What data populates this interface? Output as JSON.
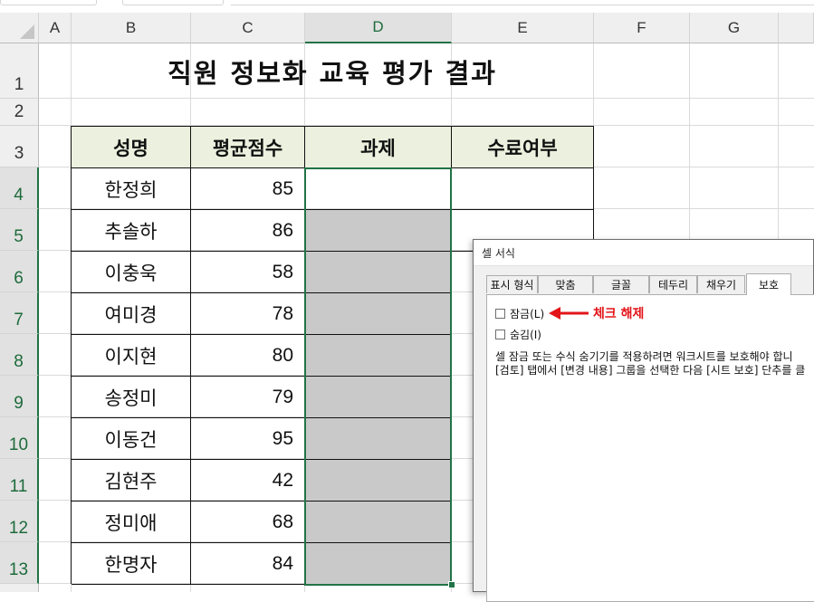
{
  "columns": [
    "A",
    "B",
    "C",
    "D",
    "E",
    "F",
    "G"
  ],
  "rows": [
    "1",
    "2",
    "3",
    "4",
    "5",
    "6",
    "7",
    "8",
    "9",
    "10",
    "11",
    "12",
    "13"
  ],
  "sheet_title": "직원 정보화 교육 평가 결과",
  "table": {
    "headers": [
      "성명",
      "평균점수",
      "과제",
      "수료여부"
    ],
    "records": [
      {
        "name": "한정희",
        "score": "85"
      },
      {
        "name": "추솔하",
        "score": "86"
      },
      {
        "name": "이충욱",
        "score": "58"
      },
      {
        "name": "여미경",
        "score": "78"
      },
      {
        "name": "이지현",
        "score": "80"
      },
      {
        "name": "송정미",
        "score": "79"
      },
      {
        "name": "이동건",
        "score": "95"
      },
      {
        "name": "김현주",
        "score": "42"
      },
      {
        "name": "정미애",
        "score": "68"
      },
      {
        "name": "한명자",
        "score": "84"
      }
    ]
  },
  "dialog": {
    "title": "셀 서식",
    "tabs": [
      "표시 형식",
      "맞춤",
      "글꼴",
      "테두리",
      "채우기",
      "보호"
    ],
    "active_tab": "보호",
    "lock_label": "잠금(L)",
    "hidden_label": "숨김(I)",
    "description_line1": "셀 잠금 또는 수식 숨기기를 적용하려면 워크시트를 보호해야 합니",
    "description_line2": "[검토] 탭에서 [변경 내용] 그룹을 선택한 다음 [시트 보호] 단추를 클"
  },
  "annotation": "체크 해제",
  "colors": {
    "header_fill": "#ebf1de",
    "locked_fill": "#c9c9c9",
    "selection": "#217346",
    "annotation": "#e3151a"
  },
  "selected_range": "D4:D13"
}
